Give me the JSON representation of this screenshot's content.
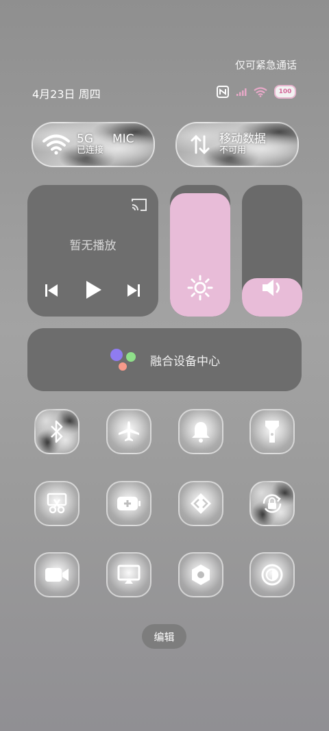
{
  "status_bar": {
    "emergency_text": "仅可紧急通话",
    "date_text": "4月23日 周四",
    "battery_level": "100"
  },
  "wifi_pill": {
    "title": "5G",
    "extra": "MIC",
    "subtitle": "已连接"
  },
  "mobile_pill": {
    "title": "移动数据",
    "subtitle": "不可用"
  },
  "media": {
    "status_text": "暂无播放"
  },
  "sliders": {
    "brightness_level": 0.94,
    "volume_level": 0.29
  },
  "device_hub": {
    "label": "融合设备中心"
  },
  "tiles": [
    {
      "name": "bluetooth",
      "active": true
    },
    {
      "name": "airplane-mode",
      "active": false
    },
    {
      "name": "ringtone",
      "active": false
    },
    {
      "name": "flashlight",
      "active": false
    },
    {
      "name": "screenshot",
      "active": false
    },
    {
      "name": "battery-saver",
      "active": false
    },
    {
      "name": "nfc-share",
      "active": false
    },
    {
      "name": "rotation-lock",
      "active": true
    },
    {
      "name": "screen-record",
      "active": false
    },
    {
      "name": "screen-cast",
      "active": false
    },
    {
      "name": "camera-settings",
      "active": false
    },
    {
      "name": "dark-mode",
      "active": false
    }
  ],
  "edit_button": {
    "label": "编辑"
  },
  "colors": {
    "accent_pink": "#e8bcd8",
    "card_dark": "#6d6d6d"
  }
}
